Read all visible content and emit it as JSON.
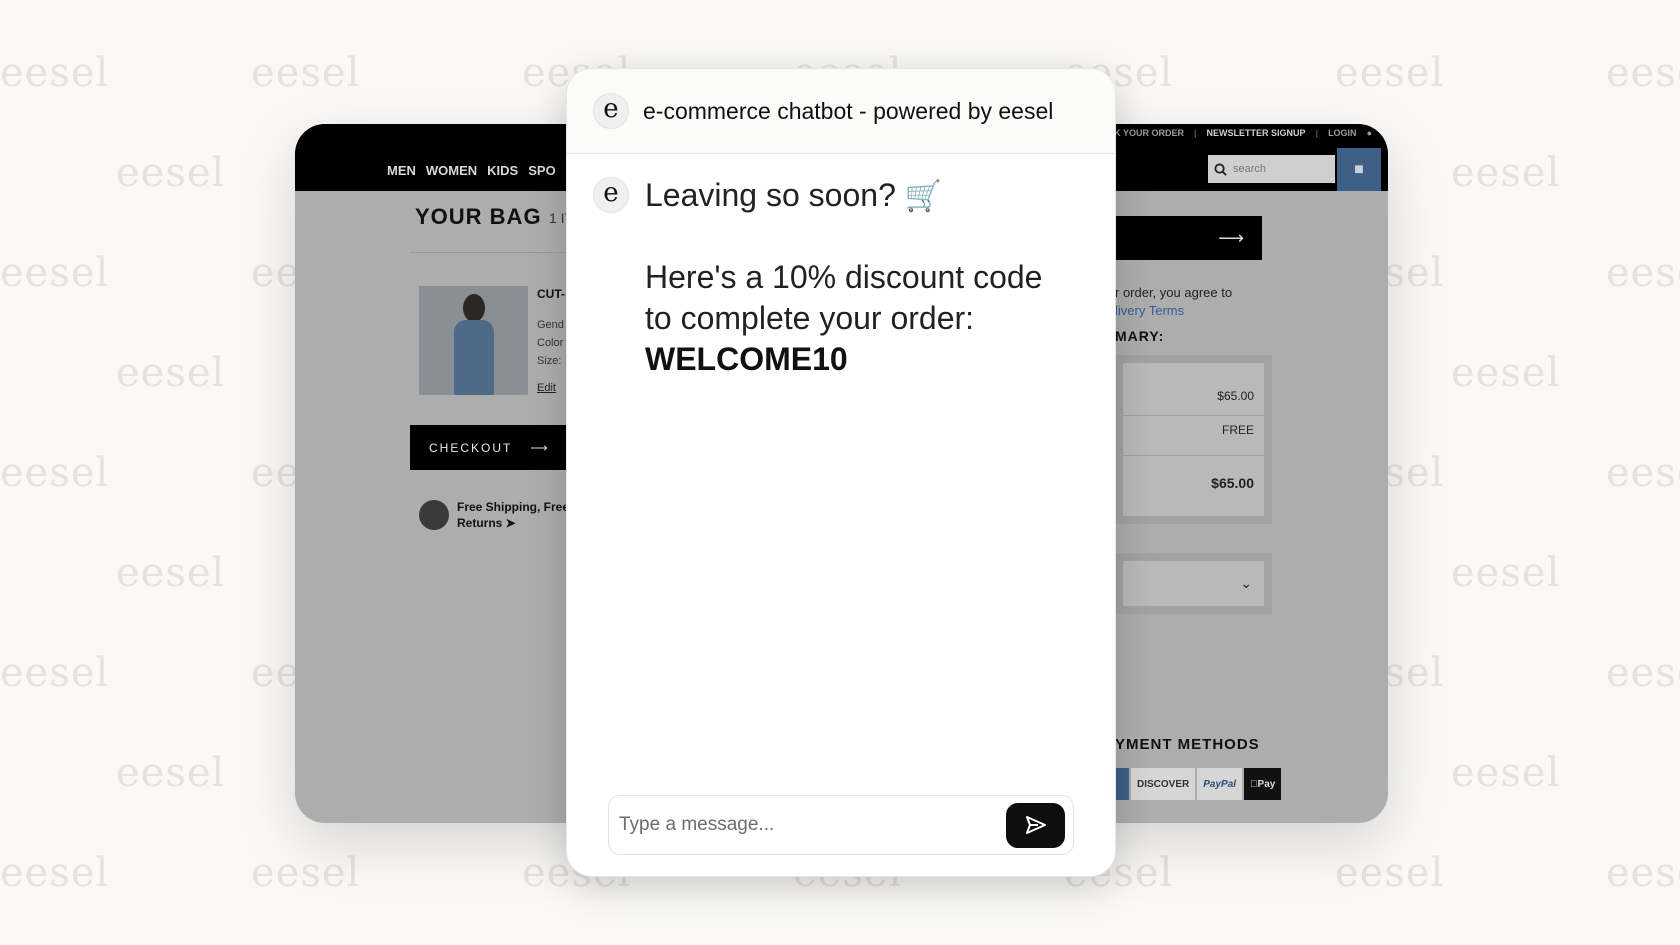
{
  "watermark": {
    "text": "eesel"
  },
  "store": {
    "nav": [
      "MEN",
      "WOMEN",
      "KIDS",
      "SPO"
    ],
    "utility": {
      "track": "CK YOUR ORDER",
      "newsletter": "NEWSLETTER SIGNUP",
      "login": "LOGIN"
    },
    "search_placeholder": "search",
    "bag_title": "YOUR BAG",
    "bag_count": "1 IT",
    "product": {
      "name": "CUT-",
      "meta": [
        "Gend",
        "Color",
        "Size:"
      ],
      "edit": "Edit"
    },
    "checkout_label": "CHECKOUT",
    "shipping": {
      "line1": "Free Shipping, Free",
      "line2": "Returns"
    },
    "agree_line1": "r order, you agree to",
    "agree_link": "livery Terms",
    "summary_label": "MARY:",
    "summary": {
      "subtotal": "$65.00",
      "shipping": "FREE",
      "total": "$65.00"
    },
    "payment_label": "YMENT METHODS",
    "payment_methods": [
      "DISCOVER",
      "PayPal",
      "Pay"
    ]
  },
  "chat": {
    "title": "e-commerce chatbot - powered by eesel",
    "avatar_letter": "e",
    "message": {
      "line1": "Leaving so soon?",
      "emoji": "🛒",
      "line2": "Here's a 10% discount code",
      "line3": "to complete your order:",
      "code": "WELCOME10"
    },
    "input_placeholder": "Type a message..."
  },
  "icons": {
    "send": "send-icon",
    "cart": "shopping-cart-icon",
    "search": "search-icon",
    "bag": "shopping-bag-icon",
    "chevron": "chevron-down-icon"
  }
}
